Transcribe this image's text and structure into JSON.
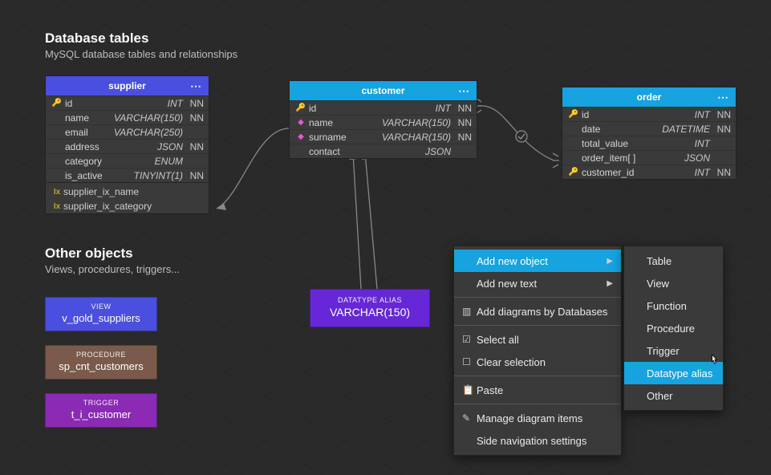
{
  "sections": {
    "db_title": "Database tables",
    "db_sub": "MySQL database tables and relationships",
    "other_title": "Other objects",
    "other_sub": "Views, procedures, triggers..."
  },
  "tables": {
    "supplier": {
      "title": "supplier",
      "columns": [
        {
          "name": "id",
          "type": "INT",
          "nn": "NN",
          "pk": true
        },
        {
          "name": "name",
          "type": "VARCHAR(150)",
          "nn": "NN"
        },
        {
          "name": "email",
          "type": "VARCHAR(250)",
          "nn": ""
        },
        {
          "name": "address",
          "type": "JSON",
          "nn": "NN"
        },
        {
          "name": "category",
          "type": "ENUM",
          "nn": ""
        },
        {
          "name": "is_active",
          "type": "TINYINT(1)",
          "nn": "NN"
        }
      ],
      "indexes": [
        {
          "name": "supplier_ix_name"
        },
        {
          "name": "supplier_ix_category"
        }
      ]
    },
    "customer": {
      "title": "customer",
      "columns": [
        {
          "name": "id",
          "type": "INT",
          "nn": "NN",
          "pk": true
        },
        {
          "name": "name",
          "type": "VARCHAR(150)",
          "nn": "NN",
          "pink": true
        },
        {
          "name": "surname",
          "type": "VARCHAR(150)",
          "nn": "NN",
          "pink": true
        },
        {
          "name": "contact",
          "type": "JSON",
          "nn": ""
        }
      ]
    },
    "order": {
      "title": "order",
      "columns": [
        {
          "name": "id",
          "type": "INT",
          "nn": "NN",
          "pk": true
        },
        {
          "name": "date",
          "type": "DATETIME",
          "nn": "NN"
        },
        {
          "name": "total_value",
          "type": "INT",
          "nn": ""
        },
        {
          "name": "order_item[ ]",
          "type": "JSON",
          "nn": ""
        },
        {
          "name": "customer_id",
          "type": "INT",
          "nn": "NN",
          "fk": true
        }
      ]
    }
  },
  "chips": {
    "view": {
      "kind": "VIEW",
      "name": "v_gold_suppliers"
    },
    "procedure": {
      "kind": "PROCEDURE",
      "name": "sp_cnt_customers"
    },
    "trigger": {
      "kind": "TRIGGER",
      "name": "t_i_customer"
    }
  },
  "alias": {
    "kind": "DATATYPE ALIAS",
    "name": "VARCHAR(150)"
  },
  "context_menu": {
    "items": [
      {
        "label": "Add new object",
        "submenu": true,
        "highlight": true
      },
      {
        "label": "Add new text",
        "submenu": true
      },
      {
        "sep": true
      },
      {
        "label": "Add diagrams by Databases",
        "icon": "grid"
      },
      {
        "sep": true
      },
      {
        "label": "Select all",
        "icon": "check"
      },
      {
        "label": "Clear selection",
        "icon": "square"
      },
      {
        "sep": true
      },
      {
        "label": "Paste",
        "icon": "paste"
      },
      {
        "sep": true
      },
      {
        "label": "Manage diagram items",
        "icon": "pencil"
      },
      {
        "label": "Side navigation settings"
      }
    ],
    "submenu": [
      {
        "label": "Table"
      },
      {
        "label": "View"
      },
      {
        "label": "Function"
      },
      {
        "label": "Procedure"
      },
      {
        "label": "Trigger"
      },
      {
        "label": "Datatype alias",
        "highlight": true
      },
      {
        "label": "Other"
      }
    ]
  }
}
